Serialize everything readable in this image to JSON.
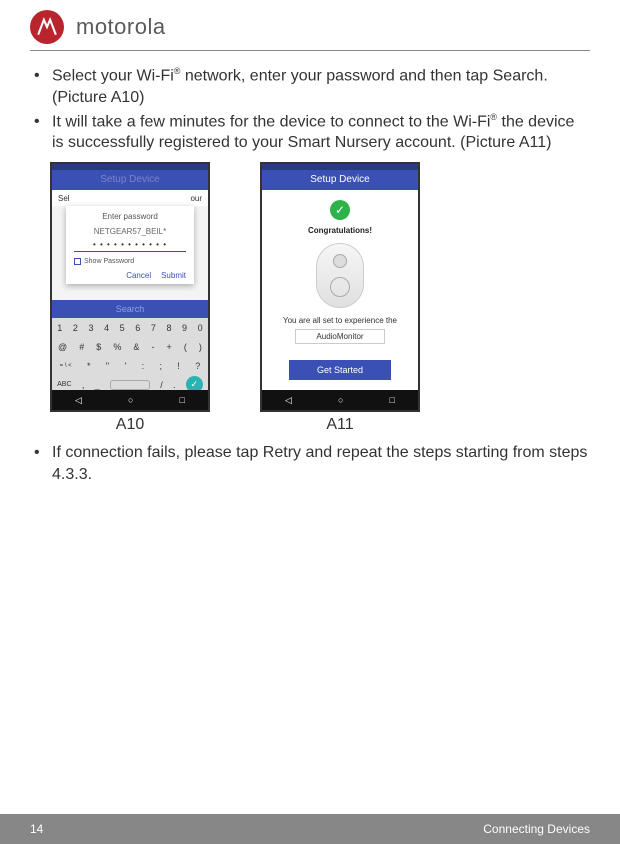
{
  "header": {
    "brand": "motorola"
  },
  "instructions": {
    "li1_a": "Select your Wi-Fi",
    "li1_sup": "®",
    "li1_b": " network, enter your password and then tap Search. (Picture A10)",
    "li2_a": "It will take a few minutes for the device to connect to the Wi-Fi",
    "li2_sup": "®",
    "li2_b": " the device is successfully registered to your Smart Nursery account. (Picture A11)",
    "li3": "If connection fails, please tap Retry and repeat the steps starting from steps 4.3.3."
  },
  "a10": {
    "title": "Setup Device",
    "subtitle_left": "Sel",
    "subtitle_right": "our",
    "search": "Search",
    "dialog": {
      "title": "Enter password",
      "network": "NETGEAR57_BEIL*",
      "password": "• • • • • • • • • • •",
      "show": "Show Password",
      "cancel": "Cancel",
      "submit": "Submit"
    },
    "kb": {
      "row1": [
        "1",
        "2",
        "3",
        "4",
        "5",
        "6",
        "7",
        "8",
        "9",
        "0"
      ],
      "row2": [
        "@",
        "#",
        "$",
        "%",
        "&",
        "-",
        "+",
        "(",
        ")"
      ],
      "row3": [
        "= \\ <",
        "*",
        "\"",
        "'",
        ":",
        ";",
        "!",
        "?"
      ],
      "row4_labels": {
        "abc": "ABC"
      },
      "row4": [
        ",",
        "_",
        "/",
        "."
      ],
      "done": "✓"
    },
    "label": "A10"
  },
  "a11": {
    "title": "Setup Device",
    "check": "✓",
    "congrats": "Congratulations!",
    "allset": "You are all set to experience the",
    "audiomon": "AudioMonitor",
    "getstarted": "Get Started",
    "label": "A11"
  },
  "nav": {
    "back": "◁",
    "home": "○",
    "recent": "□"
  },
  "footer": {
    "page": "14",
    "section": "Connecting Devices"
  }
}
